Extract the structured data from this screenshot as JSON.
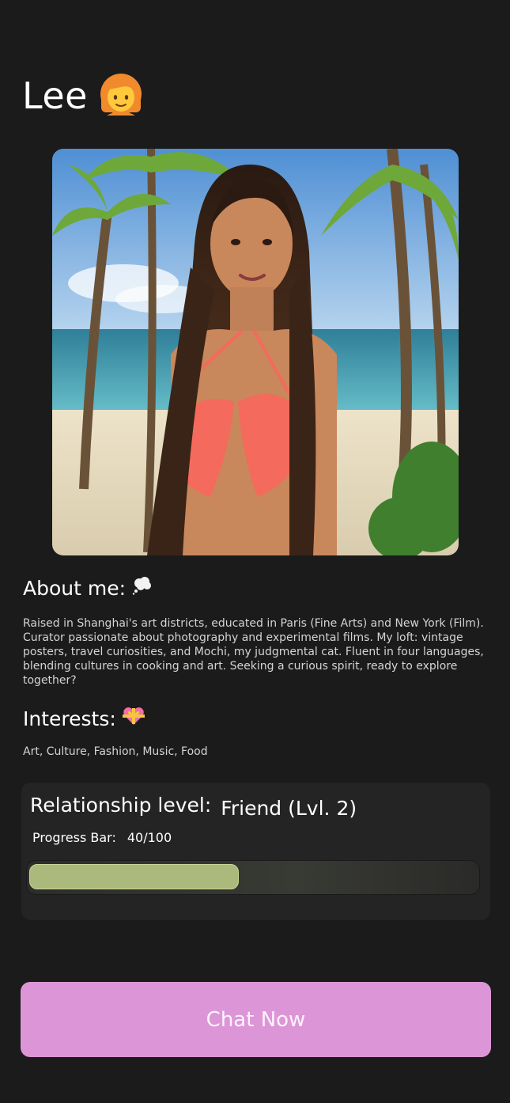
{
  "profile": {
    "name": "Lee",
    "name_emoji": "👩",
    "photo_icon": "profile-photo"
  },
  "about": {
    "title": "About me:",
    "emoji": "💭",
    "text": "Raised in Shanghai's art districts, educated in Paris (Fine Arts) and New York (Film). Curator passionate about photography and experimental films. My loft: vintage posters, travel curiosities, and Mochi, my judgmental cat. Fluent in four languages, blending cultures in cooking and art. Seeking a curious spirit, ready to explore together?"
  },
  "interests": {
    "title": "Interests:",
    "emoji": "💝",
    "text": "Art, Culture, Fashion, Music, Food"
  },
  "relationship": {
    "title": "Relationship level:",
    "level": "Friend (Lvl. 2)",
    "progress_label": "Progress Bar:",
    "progress_value": "40/100",
    "progress_fraction": 0.4,
    "bar_color": "#abba7c"
  },
  "cta": {
    "label": "Chat Now",
    "color": "#dc96d7"
  }
}
